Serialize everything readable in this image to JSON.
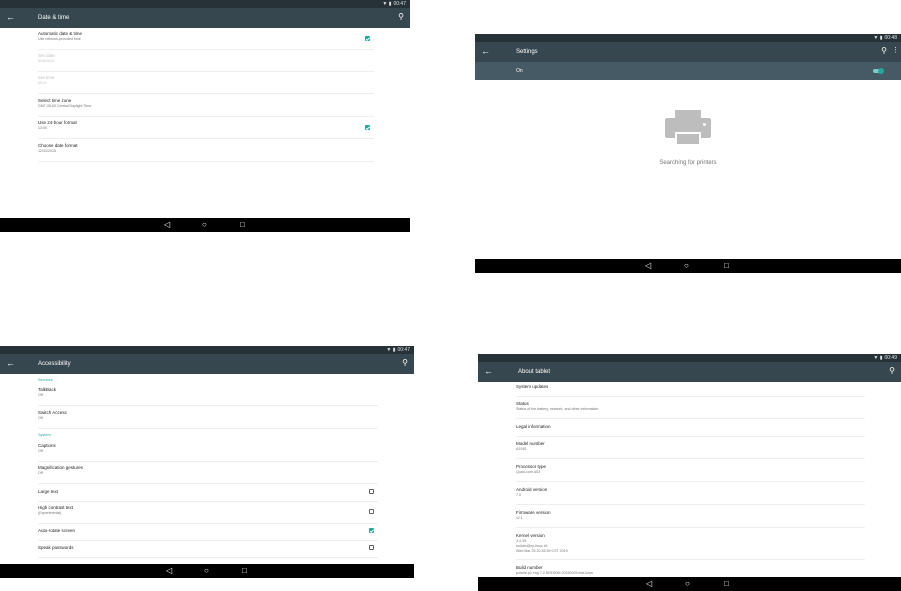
{
  "colors": {
    "statusbar": "#263238",
    "appbar": "#37474f",
    "toggle_row": "#455a64",
    "accent": "#26a69a",
    "navbar": "#000000"
  },
  "status_time_1": "00:47",
  "status_time_2": "00:48",
  "status_time_3": "00:47",
  "status_time_4": "00:49",
  "nav": {
    "back": "◁",
    "home": "○",
    "recents": "□"
  },
  "icons": {
    "back": "←",
    "search": "⚲",
    "more": "⋮"
  },
  "date_time": {
    "title": "Date & time",
    "items": [
      {
        "title": "Automatic date & time",
        "sub": "Use network-provided time",
        "checked": true
      },
      {
        "title": "Set date",
        "sub": "5/16/2019",
        "disabled": true
      },
      {
        "title": "Set time",
        "sub": "00:47",
        "disabled": true
      },
      {
        "title": "Select time zone",
        "sub": "GMT-05:00 Central Daylight Time"
      },
      {
        "title": "Use 24-hour format",
        "sub": "13:00",
        "checked": true
      },
      {
        "title": "Choose date format",
        "sub": "12/31/2015"
      }
    ]
  },
  "printing": {
    "title": "Settings",
    "toggle_label": "On",
    "message": "Searching for printers"
  },
  "accessibility": {
    "title": "Accessibility",
    "section_services": "Services",
    "section_system": "System",
    "items": [
      {
        "title": "TalkBack",
        "sub": "Off"
      },
      {
        "title": "Switch Access",
        "sub": "Off"
      },
      {
        "title": "Captions",
        "sub": "Off"
      },
      {
        "title": "Magnification gestures",
        "sub": "Off"
      },
      {
        "title": "Large text",
        "checked": false
      },
      {
        "title": "High contrast text",
        "sub": "(Experimental)",
        "checked": false
      },
      {
        "title": "Auto-rotate screen",
        "checked": true
      },
      {
        "title": "Speak passwords",
        "checked": false
      }
    ]
  },
  "about": {
    "title": "About tablet",
    "items": [
      {
        "title": "System updates"
      },
      {
        "title": "Status",
        "sub": "Status of the battery, network, and other information"
      },
      {
        "title": "Legal information"
      },
      {
        "title": "Model number",
        "sub": "A1045"
      },
      {
        "title": "Processor type",
        "sub": "Quad-core A53"
      },
      {
        "title": "Android version",
        "sub": "7.0"
      },
      {
        "title": "Firmware version",
        "sub": "v2.1"
      },
      {
        "title": "Kernel version",
        "sub": "3.4.39",
        "sub2": "builder@xp-linux #1",
        "sub3": "Wed Mar 25 20:33:39 CST 2019"
      },
      {
        "title": "Build number",
        "sub": "polaris-p2 eng 7.0 NRD90M 20190325 test-keys"
      }
    ]
  }
}
